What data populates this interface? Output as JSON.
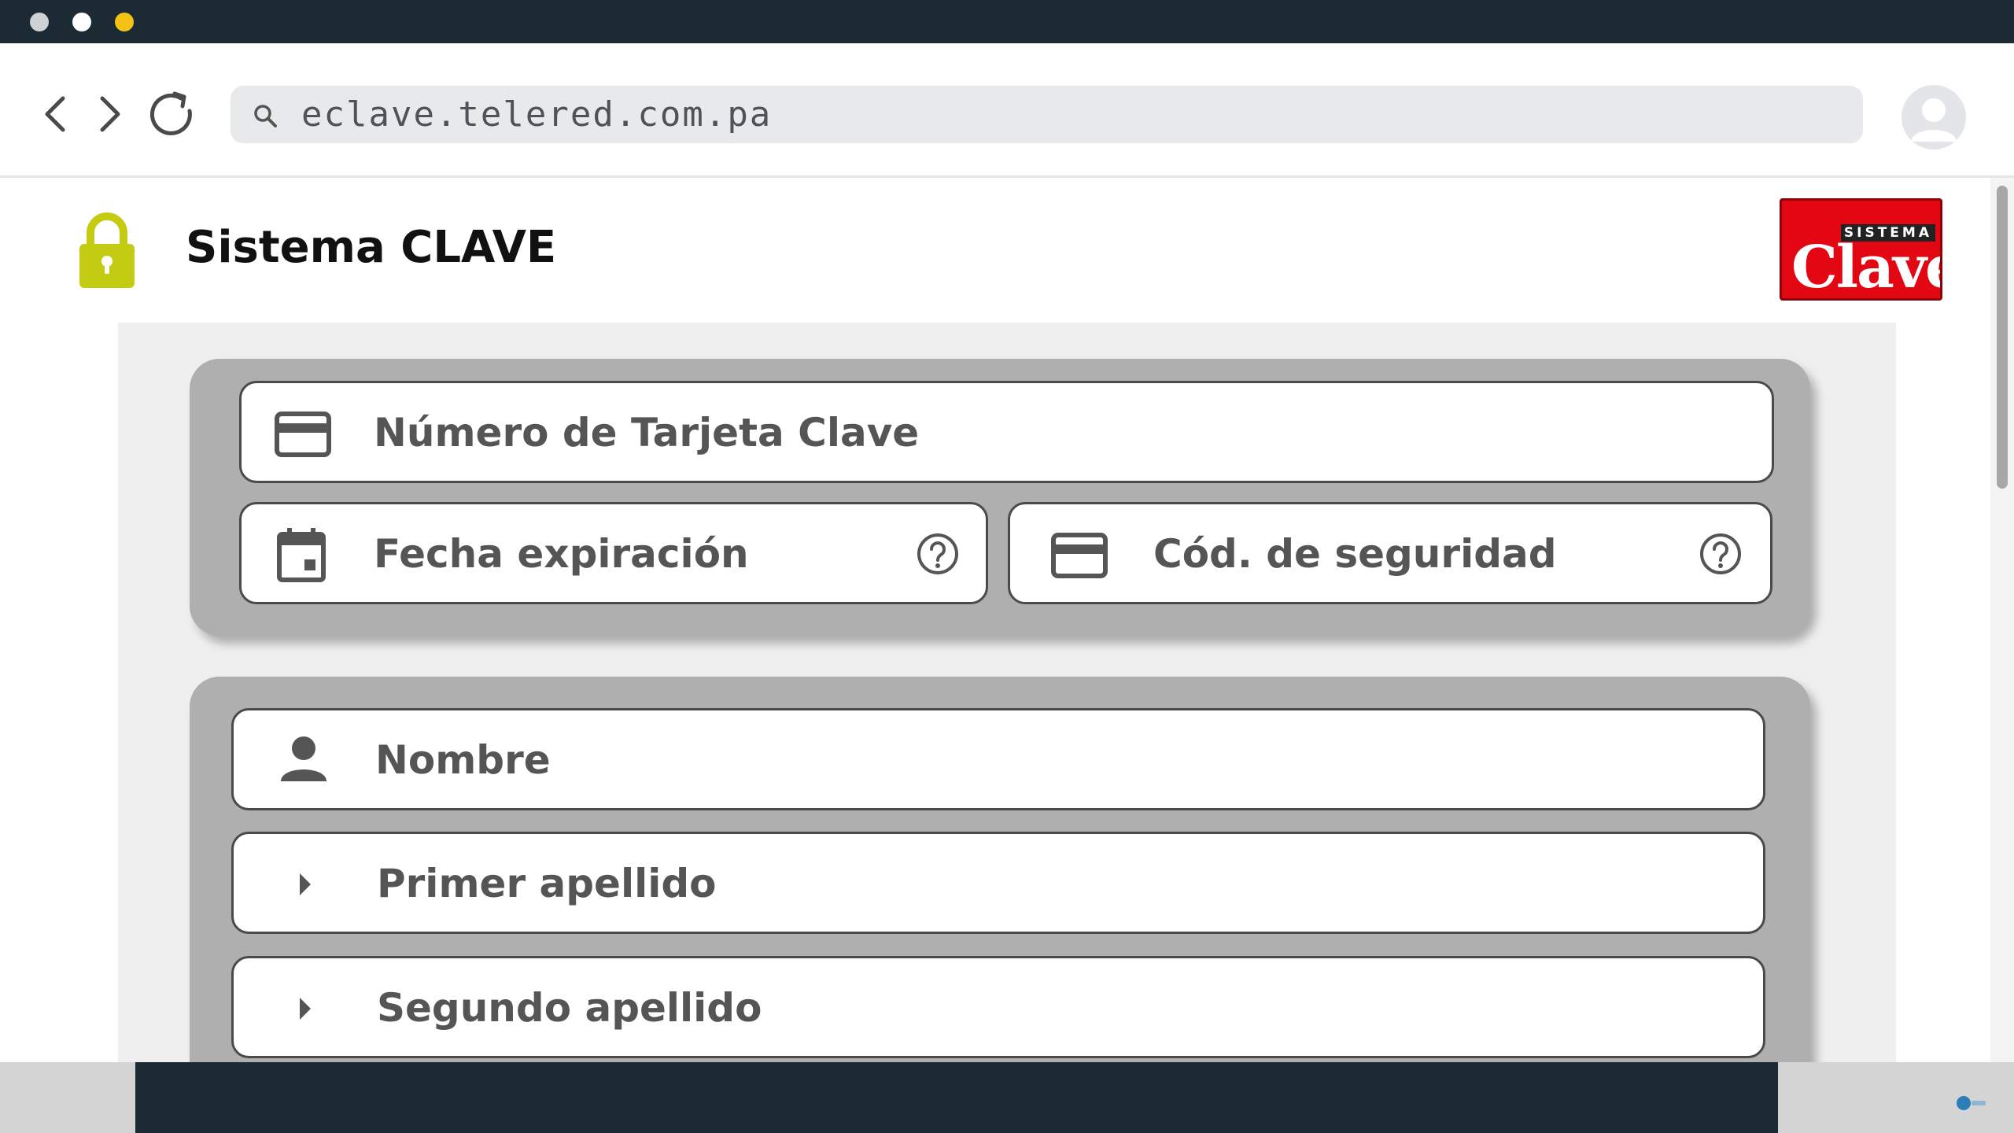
{
  "window": {
    "dots": [
      "#cfd2d4",
      "#ffffff",
      "#f2c315"
    ]
  },
  "browser": {
    "url": "eclave.telered.com.pa",
    "icons": [
      "back-arrow-icon",
      "forward-arrow-icon",
      "reload-icon",
      "search-icon",
      "profile-icon"
    ]
  },
  "header": {
    "title": "Sistema CLAVE",
    "brand_top": "SISTEMA",
    "brand_name": "Clave",
    "lock_color": "#c3cc12",
    "brand_color": "#e30613"
  },
  "card_section": {
    "card_number_label": "Número de Tarjeta Clave",
    "expiry_label": "Fecha expiración",
    "security_code_label": "Cód. de seguridad"
  },
  "personal_section": {
    "name_label": "Nombre",
    "first_surname_label": "Primer apellido",
    "second_surname_label": "Segundo apellido"
  },
  "colors": {
    "panel": "#afafaf",
    "dark_bar": "#1b2a33"
  }
}
